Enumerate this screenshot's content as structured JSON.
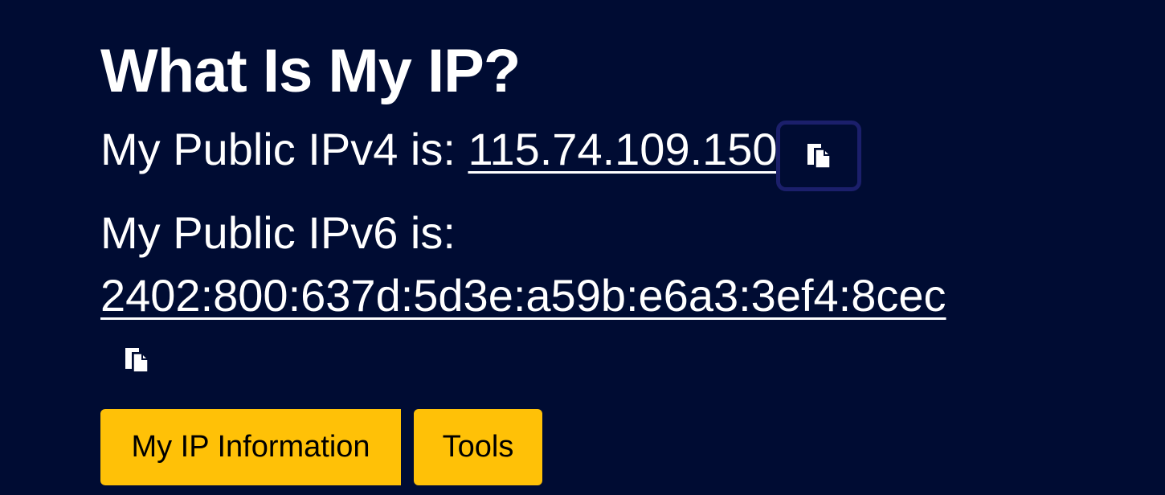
{
  "header": {
    "title": "What Is My IP?"
  },
  "ipv4": {
    "label": "My Public IPv4 is:",
    "value": "115.74.109.150"
  },
  "ipv6": {
    "label": "My Public IPv6 is:",
    "value": "2402:800:637d:5d3e:a59b:e6a3:3ef4:8cec"
  },
  "icons": {
    "copy": "copy-icon"
  },
  "actions": {
    "info_label": "My IP Information",
    "tools_label": "Tools"
  },
  "colors": {
    "background": "#000c33",
    "accent": "#ffc107",
    "focus_ring": "#1b1f6b"
  }
}
